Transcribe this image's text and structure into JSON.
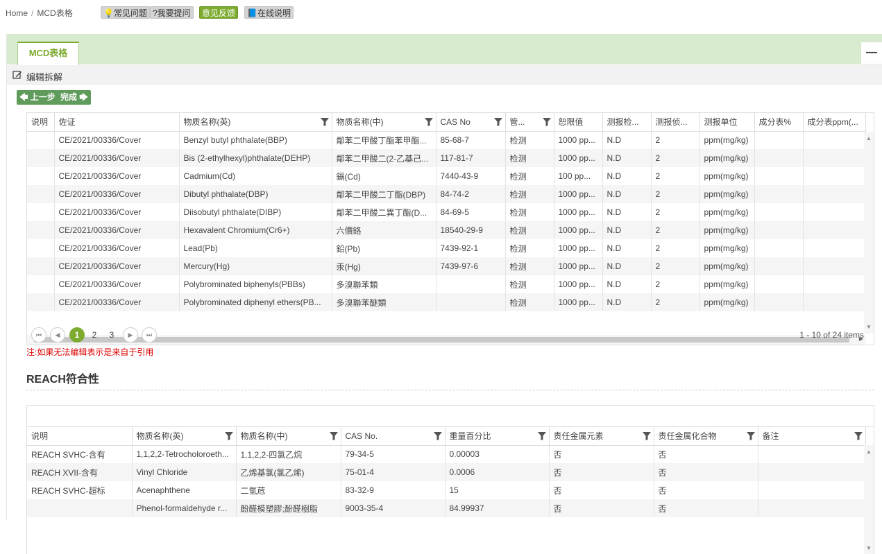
{
  "breadcrumb": {
    "home": "Home",
    "separator": "/",
    "current": "MCD表格"
  },
  "top_buttons": [
    {
      "label": "💡常见问题",
      "icon": "lightbulb-icon"
    },
    {
      "label": "?我要提问",
      "icon": "question-icon"
    },
    {
      "label": "意见反馈",
      "icon": ""
    },
    {
      "label": "📘在线说明",
      "icon": "book-icon"
    }
  ],
  "tab": {
    "label": "MCD表格",
    "collapse": "—"
  },
  "edit": {
    "label": "编辑拆解"
  },
  "nav": {
    "prev": "上一步",
    "finish": "完成"
  },
  "grid1": {
    "columns": [
      "说明",
      "佐证",
      "物质名称(英)",
      "物质名称(中)",
      "CAS No",
      "管...",
      "恕限值",
      "测报检...",
      "测报侦...",
      "测报单位",
      "成分表%",
      "成分表ppm(..."
    ],
    "rows": [
      [
        "",
        "CE/2021/00336/Cover",
        "Benzyl butyl phthalate(BBP)",
        "鄰苯二甲酸丁酯苯甲酯...",
        "85-68-7",
        "检测",
        "1000 pp...",
        "N.D",
        "2",
        "ppm(mg/kg)",
        "",
        ""
      ],
      [
        "",
        "CE/2021/00336/Cover",
        "Bis (2-ethylhexyl)phthalate(DEHP)",
        "鄰苯二甲酸二(2-乙基己...",
        "117-81-7",
        "检测",
        "1000 pp...",
        "N.D",
        "2",
        "ppm(mg/kg)",
        "",
        ""
      ],
      [
        "",
        "CE/2021/00336/Cover",
        "Cadmium(Cd)",
        "鎘(Cd)",
        "7440-43-9",
        "检测",
        "100 pp...",
        "N.D",
        "2",
        "ppm(mg/kg)",
        "",
        ""
      ],
      [
        "",
        "CE/2021/00336/Cover",
        "Dibutyl phthalate(DBP)",
        "鄰苯二甲酸二丁酯(DBP)",
        "84-74-2",
        "检测",
        "1000 pp...",
        "N.D",
        "2",
        "ppm(mg/kg)",
        "",
        ""
      ],
      [
        "",
        "CE/2021/00336/Cover",
        "Diisobutyl phthalate(DIBP)",
        "鄰苯二甲酸二異丁酯(D...",
        "84-69-5",
        "检测",
        "1000 pp...",
        "N.D",
        "2",
        "ppm(mg/kg)",
        "",
        ""
      ],
      [
        "",
        "CE/2021/00336/Cover",
        "Hexavalent Chromium(Cr6+)",
        "六價鉻",
        "18540-29-9",
        "检测",
        "1000 pp...",
        "N.D",
        "2",
        "ppm(mg/kg)",
        "",
        ""
      ],
      [
        "",
        "CE/2021/00336/Cover",
        "Lead(Pb)",
        "鉛(Pb)",
        "7439-92-1",
        "检测",
        "1000 pp...",
        "N.D",
        "2",
        "ppm(mg/kg)",
        "",
        ""
      ],
      [
        "",
        "CE/2021/00336/Cover",
        "Mercury(Hg)",
        "汞(Hg)",
        "7439-97-6",
        "检测",
        "1000 pp...",
        "N.D",
        "2",
        "ppm(mg/kg)",
        "",
        ""
      ],
      [
        "",
        "CE/2021/00336/Cover",
        "Polybrominated biphenyls(PBBs)",
        "多溴聯苯類",
        "",
        "检测",
        "1000 pp...",
        "N.D",
        "2",
        "ppm(mg/kg)",
        "",
        ""
      ],
      [
        "",
        "CE/2021/00336/Cover",
        "Polybrominated diphenyl ethers(PB...",
        "多溴聯苯醚類",
        "",
        "检测",
        "1000 pp...",
        "N.D",
        "2",
        "ppm(mg/kg)",
        "",
        ""
      ]
    ]
  },
  "pager": {
    "pages": [
      "1",
      "2",
      "3"
    ],
    "current": "1",
    "info": "1 - 10 of 24 items"
  },
  "note": "注:如果无法编辑表示是来自于引用",
  "section": {
    "title": "REACH符合性"
  },
  "grid2": {
    "columns": [
      "说明",
      "物质名称(英)",
      "物质名称(中)",
      "CAS No.",
      "重量百分比",
      "责任金属元素",
      "责任金属化合物",
      "备注"
    ],
    "rows": [
      [
        "REACH SVHC-含有",
        "1,1,2,2-Tetrocholoroeth...",
        "1,1,2,2-四氯乙烷",
        "79-34-5",
        "0.00003",
        "否",
        "否",
        ""
      ],
      [
        "REACH XVII-含有",
        "Vinyl Chloride",
        "乙烯基氯(氯乙烯)",
        "75-01-4",
        "0.0006",
        "否",
        "否",
        ""
      ],
      [
        "REACH SVHC-超标",
        "Acenaphthene",
        "二氫苊",
        "83-32-9",
        "15",
        "否",
        "否",
        ""
      ],
      [
        "",
        "Phenol-formaldehyde r...",
        "酚醛模塑膠;酚醛樹脂",
        "9003-35-4",
        "84.99937",
        "否",
        "否",
        ""
      ]
    ]
  },
  "colors": {
    "accent": "#7cab2f",
    "nav_button": "#5f9b5a",
    "tab_strip": "#d9ebcf",
    "link": "#2a5f9e",
    "note": "#dd0000"
  }
}
